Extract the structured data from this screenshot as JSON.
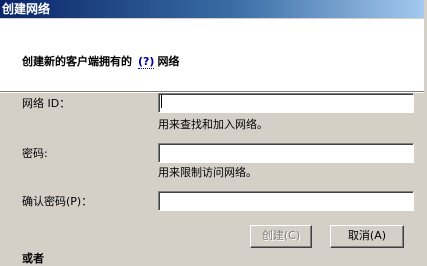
{
  "window": {
    "title": "创建网络"
  },
  "header": {
    "heading_prefix": "创建新的客户端拥有的",
    "help_link": "(?)",
    "heading_suffix": "网络"
  },
  "form": {
    "network_id": {
      "label": "网络 ID：",
      "value": "",
      "hint": "用来查找和加入网络。"
    },
    "password": {
      "label": "密码:",
      "value": "",
      "hint": "用来限制访问网络。"
    },
    "confirm_password": {
      "label": "确认密码(P)：",
      "value": ""
    }
  },
  "buttons": {
    "create": "创建(C)",
    "cancel": "取消(A)"
  },
  "section": {
    "or_label": "或者"
  }
}
